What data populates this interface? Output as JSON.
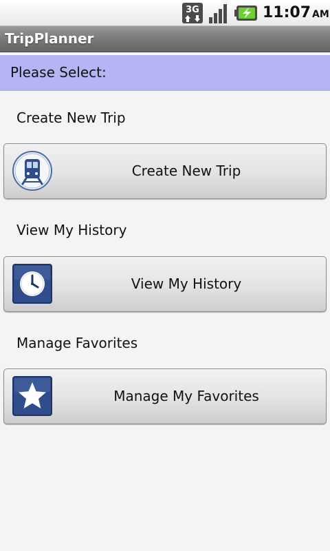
{
  "status_bar": {
    "network_type": "3G",
    "time": "11:07",
    "ampm": "AM",
    "icons": [
      "3g-data-icon",
      "signal-strength-icon",
      "battery-charging-icon"
    ]
  },
  "app": {
    "title": "TripPlanner"
  },
  "prompt": {
    "text": "Please Select:"
  },
  "sections": [
    {
      "label": "Create New Trip",
      "button_label": "Create New Trip",
      "icon": "train-icon"
    },
    {
      "label": "View My History",
      "button_label": "View My History",
      "icon": "clock-icon"
    },
    {
      "label": "Manage Favorites",
      "button_label": "Manage My Favorites",
      "icon": "star-icon"
    }
  ],
  "colors": {
    "prompt_background": "#b5b5f4",
    "title_bar": "#7c7c7c",
    "icon_blue": "#2e4d8a",
    "page_background": "#f4f4f4"
  }
}
